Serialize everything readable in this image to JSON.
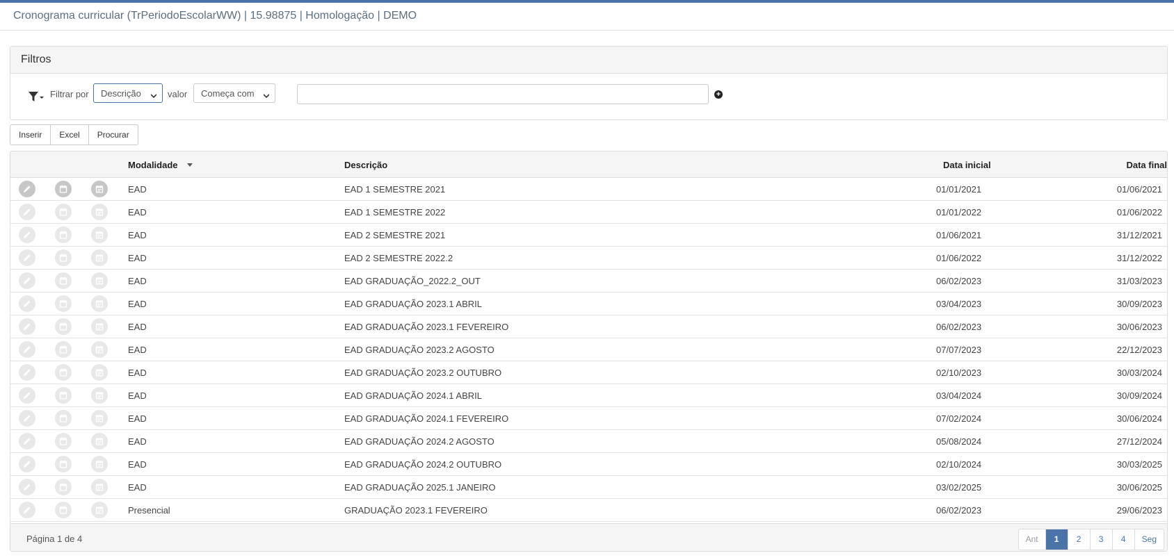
{
  "header": {
    "title": "Cronograma curricular (TrPeriodoEscolarWW) | 15.98875 | Homologação | DEMO"
  },
  "filters": {
    "title": "Filtros",
    "filter_by_label": "Filtrar por",
    "filter_field_selected": "Descrição",
    "value_label": "valor",
    "operator_selected": "Começa com",
    "value_input": ""
  },
  "toolbar": {
    "insert_label": "Inserir",
    "excel_label": "Excel",
    "search_label": "Procurar"
  },
  "table": {
    "columns": [
      "Modalidade",
      "Descrição",
      "Data inicial",
      "Data final"
    ],
    "rows": [
      {
        "modalidade": "EAD",
        "descricao": "EAD 1 SEMESTRE 2021",
        "inicio": "01/01/2021",
        "fim": "01/06/2021"
      },
      {
        "modalidade": "EAD",
        "descricao": "EAD 1 SEMESTRE 2022",
        "inicio": "01/01/2022",
        "fim": "01/06/2022"
      },
      {
        "modalidade": "EAD",
        "descricao": "EAD 2 SEMESTRE 2021",
        "inicio": "01/06/2021",
        "fim": "31/12/2021"
      },
      {
        "modalidade": "EAD",
        "descricao": "EAD 2 SEMESTRE 2022.2",
        "inicio": "01/06/2022",
        "fim": "31/12/2022"
      },
      {
        "modalidade": "EAD",
        "descricao": "EAD GRADUAÇÃO_2022.2_OUT",
        "inicio": "06/02/2023",
        "fim": "31/03/2023"
      },
      {
        "modalidade": "EAD",
        "descricao": "EAD GRADUAÇÃO 2023.1 ABRIL",
        "inicio": "03/04/2023",
        "fim": "30/09/2023"
      },
      {
        "modalidade": "EAD",
        "descricao": "EAD GRADUAÇÃO 2023.1 FEVEREIRO",
        "inicio": "06/02/2023",
        "fim": "30/06/2023"
      },
      {
        "modalidade": "EAD",
        "descricao": "EAD GRADUAÇÃO 2023.2 AGOSTO",
        "inicio": "07/07/2023",
        "fim": "22/12/2023"
      },
      {
        "modalidade": "EAD",
        "descricao": "EAD GRADUAÇÃO 2023.2 OUTUBRO",
        "inicio": "02/10/2023",
        "fim": "30/03/2024"
      },
      {
        "modalidade": "EAD",
        "descricao": "EAD GRADUAÇÃO 2024.1 ABRIL",
        "inicio": "03/04/2024",
        "fim": "30/09/2024"
      },
      {
        "modalidade": "EAD",
        "descricao": "EAD GRADUAÇÃO 2024.1 FEVEREIRO",
        "inicio": "07/02/2024",
        "fim": "30/06/2024"
      },
      {
        "modalidade": "EAD",
        "descricao": "EAD GRADUAÇÃO 2024.2 AGOSTO",
        "inicio": "05/08/2024",
        "fim": "27/12/2024"
      },
      {
        "modalidade": "EAD",
        "descricao": "EAD GRADUAÇÃO 2024.2 OUTUBRO",
        "inicio": "02/10/2024",
        "fim": "30/03/2025"
      },
      {
        "modalidade": "EAD",
        "descricao": "EAD GRADUAÇÃO 2025.1 JANEIRO",
        "inicio": "03/02/2025",
        "fim": "30/06/2025"
      },
      {
        "modalidade": "Presencial",
        "descricao": "GRADUAÇÃO 2023.1 FEVEREIRO",
        "inicio": "06/02/2023",
        "fim": "29/06/2023"
      }
    ],
    "row_icons": [
      "edit-icon",
      "calendar-icon",
      "calendar-grid-icon"
    ]
  },
  "footer": {
    "page_info": "Página 1 de 4",
    "pager": [
      "Ant",
      "1",
      "2",
      "3",
      "4",
      "Seg"
    ],
    "current_page": "1"
  },
  "colors": {
    "accent": "#4a73a8",
    "header_bg": "#f5f5f5",
    "icon_bg": "#e8e8e8"
  }
}
